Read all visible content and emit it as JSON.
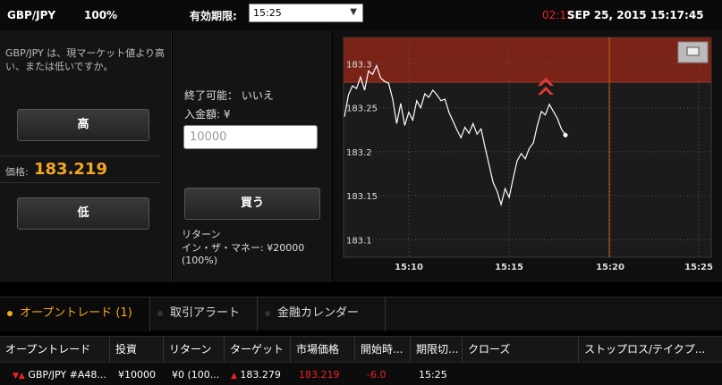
{
  "header": {
    "symbol": "GBP/JPY",
    "payout": "100%",
    "expiry_label": "有効期限:",
    "expiry_value": "15:25",
    "countdown": "02:15",
    "datetime": "SEP 25, 2015 15:17:45"
  },
  "left_panel": {
    "question": "GBP/JPY は、現マーケット値より高い、または低いですか。",
    "high_label": "高",
    "price_label": "価格:",
    "price_value": "183.219",
    "low_label": "低"
  },
  "mid_panel": {
    "early_close": "終了可能： いいえ",
    "deposit_label": "入金額: ¥",
    "amount_placeholder": "10000",
    "buy_label": "買う",
    "return_label": "リターン",
    "return_value": "イン・ザ・マネー: ¥20000 (100%)"
  },
  "chart_data": {
    "type": "line",
    "y_ticks": [
      "183.3",
      "183.25",
      "183.2",
      "183.15",
      "183.1"
    ],
    "x_ticks": [
      "15:10",
      "15:15",
      "15:20",
      "15:25"
    ],
    "ylim": [
      183.08,
      183.33
    ],
    "target_price": 183.279,
    "colors": {
      "zone": "#7a2418",
      "line": "#ffffff",
      "expiry": "#d35400",
      "arrow": "#e53935"
    },
    "series": [
      {
        "values": [
          183.24,
          183.265,
          183.275,
          183.272,
          183.285,
          183.27,
          183.292,
          183.288,
          183.298,
          183.284,
          183.28,
          183.278,
          183.26,
          183.232,
          183.255,
          183.23,
          183.245,
          183.236,
          183.258,
          183.25,
          183.266,
          183.262,
          183.27,
          183.265,
          183.258,
          183.26,
          183.245,
          183.235,
          183.225,
          183.216,
          183.228,
          183.221,
          183.232,
          183.22,
          183.226,
          183.205,
          183.185,
          183.165,
          183.155,
          183.14,
          183.158,
          183.148,
          183.17,
          183.19,
          183.198,
          183.192,
          183.204,
          183.21,
          183.23,
          183.246,
          183.242,
          183.254,
          183.246,
          183.238,
          183.226,
          183.219
        ]
      }
    ]
  },
  "tabs": [
    {
      "label": "オープントレード (1)"
    },
    {
      "label": "取引アラート"
    },
    {
      "label": "金融カレンダー"
    }
  ],
  "table": {
    "columns": [
      "オープントレード",
      "投資",
      "リターン",
      "ターゲット",
      "市場価格",
      "開始時...",
      "期限切...",
      "クローズ",
      "ストップロス/テイクプ..."
    ],
    "row": {
      "trade": "GBP/JPY #A48...",
      "investment": "¥10000",
      "return": "¥0 (100...",
      "target": "183.279",
      "market_price": "183.219",
      "change": "-6.0",
      "expiry": "15:25"
    }
  }
}
